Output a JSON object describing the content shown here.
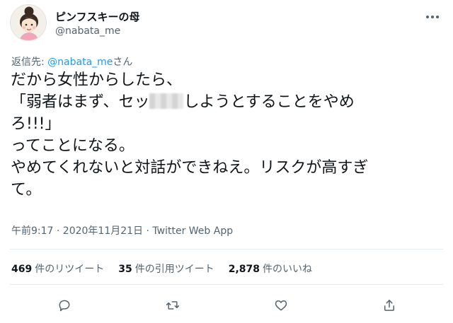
{
  "author": {
    "display_name": "ピンフスキーの母",
    "handle": "@nabata_me",
    "avatar": "woman-with-bun-cartoon-avatar"
  },
  "reply": {
    "prefix": "返信先: ",
    "mention": "@nabata_me",
    "suffix": "さん"
  },
  "tweet": {
    "lines": [
      "だから女性からしたら、",
      "「弱者はまず、セッ",
      "しようとすることをやめ",
      "ろ!!!」",
      "ってことになる。",
      "やめてくれないと対話ができねえ。リスクが高すぎ",
      "て。"
    ]
  },
  "meta": {
    "time_date": "午前9:17 · 2020年11月21日 · ",
    "via": "Twitter Web App"
  },
  "stats": {
    "retweets_count": "469",
    "retweets_label": "件のリツイート",
    "quotes_count": "35",
    "quotes_label": "件の引用ツイート",
    "likes_count": "2,878",
    "likes_label": "件のいいね"
  },
  "icons": {
    "more": "more-dots-icon",
    "reply": "reply-bubble-icon",
    "retweet": "retweet-icon",
    "like": "heart-icon",
    "share": "share-icon"
  },
  "colors": {
    "link": "#1d9bf0",
    "secondary_text": "#536471",
    "primary_text": "#0f1419"
  }
}
